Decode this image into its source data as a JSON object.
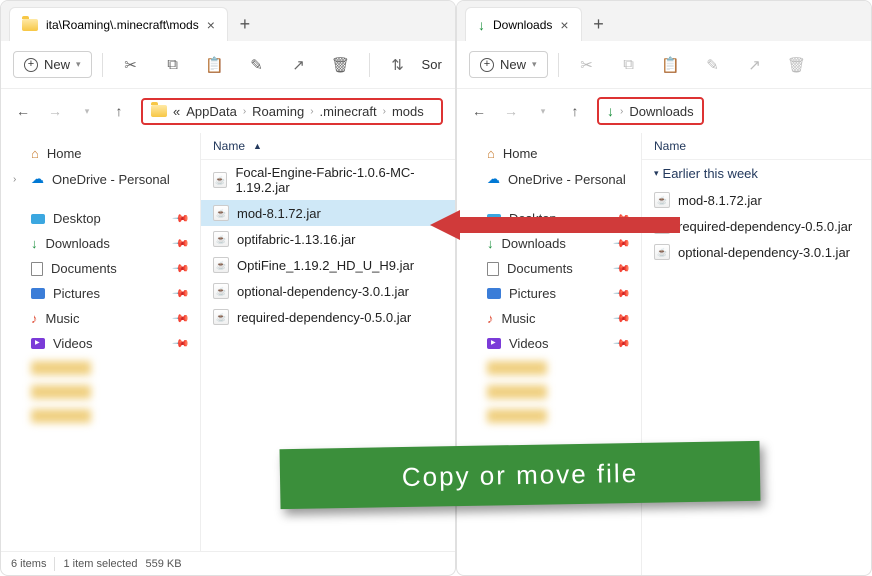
{
  "left": {
    "tab_title": "ita\\Roaming\\.minecraft\\mods",
    "new_label": "New",
    "sort_label": "Sor",
    "breadcrumb": [
      "AppData",
      "Roaming",
      ".minecraft",
      "mods"
    ],
    "bc_prefix": "«",
    "sidebar": {
      "home": "Home",
      "onedrive": "OneDrive - Personal",
      "desktop": "Desktop",
      "downloads": "Downloads",
      "documents": "Documents",
      "pictures": "Pictures",
      "music": "Music",
      "videos": "Videos"
    },
    "col_name": "Name",
    "files": [
      "Focal-Engine-Fabric-1.0.6-MC-1.19.2.jar",
      "mod-8.1.72.jar",
      "optifabric-1.13.16.jar",
      "OptiFine_1.19.2_HD_U_H9.jar",
      "optional-dependency-3.0.1.jar",
      "required-dependency-0.5.0.jar"
    ],
    "selected_index": 1,
    "status": {
      "count": "6 items",
      "selected": "1 item selected",
      "size": "559 KB"
    }
  },
  "right": {
    "tab_title": "Downloads",
    "new_label": "New",
    "breadcrumb": [
      "Downloads"
    ],
    "col_name": "Name",
    "group": "Earlier this week",
    "files": [
      "mod-8.1.72.jar",
      "required-dependency-0.5.0.jar",
      "optional-dependency-3.0.1.jar"
    ],
    "sidebar": {
      "home": "Home",
      "onedrive": "OneDrive - Personal",
      "desktop": "Desktop",
      "downloads": "Downloads",
      "documents": "Documents",
      "pictures": "Pictures",
      "music": "Music",
      "videos": "Videos"
    }
  },
  "banner_text": "Copy or move file"
}
